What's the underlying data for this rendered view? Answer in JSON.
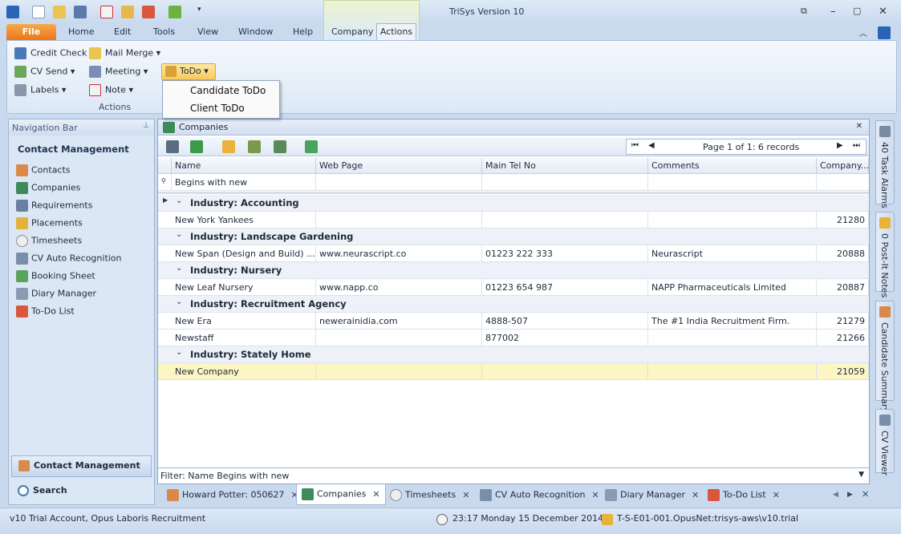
{
  "window": {
    "title": "TriSys Version 10"
  },
  "ribbon_tabs": {
    "file": "File",
    "home": "Home",
    "edit": "Edit",
    "tools": "Tools",
    "view": "View",
    "window": "Window",
    "help": "Help",
    "company": "Company",
    "actions": "Actions"
  },
  "ribbon": {
    "credit_check": "Credit Check",
    "mail_merge": "Mail Merge",
    "cv_send": "CV Send",
    "meeting": "Meeting",
    "labels": "Labels",
    "note": "Note",
    "todo": "ToDo",
    "group_label": "Actions"
  },
  "todo_menu": {
    "candidate": "Candidate ToDo",
    "client": "Client ToDo"
  },
  "nav": {
    "header": "Navigation Bar",
    "section": "Contact Management",
    "items": [
      "Contacts",
      "Companies",
      "Requirements",
      "Placements",
      "Timesheets",
      "CV Auto Recognition",
      "Booking Sheet",
      "Diary Manager",
      "To-Do List"
    ],
    "bottom1": "Contact Management",
    "bottom2": "Search"
  },
  "panel": {
    "title": "Companies",
    "pager": "Page 1 of 1: 6 records",
    "filter_row": "Begins with new",
    "filter_status": "Filter: Name Begins with new"
  },
  "grid": {
    "columns": [
      "Name",
      "Web Page",
      "Main Tel No",
      "Comments",
      "Company..."
    ],
    "groups": [
      {
        "label": "Industry: Accounting",
        "rows": [
          {
            "name": "New York Yankees",
            "web": "",
            "tel": "",
            "comments": "",
            "id": "21280"
          }
        ]
      },
      {
        "label": "Industry: Landscape Gardening",
        "rows": [
          {
            "name": "New Span (Design and Build) ...",
            "web": "www.neurascript.co",
            "tel": "01223 222 333",
            "comments": "Neurascript",
            "id": "20888"
          }
        ]
      },
      {
        "label": "Industry: Nursery",
        "rows": [
          {
            "name": "New Leaf Nursery",
            "web": "www.napp.co",
            "tel": "01223 654 987",
            "comments": "NAPP Pharmaceuticals Limited",
            "id": "20887"
          }
        ]
      },
      {
        "label": "Industry: Recruitment Agency",
        "rows": [
          {
            "name": "New Era",
            "web": "newerainidia.com",
            "tel": "4888-507",
            "comments": "The #1 India Recruitment Firm.",
            "id": "21279"
          },
          {
            "name": "Newstaff",
            "web": "",
            "tel": "877002",
            "comments": "",
            "id": "21266"
          }
        ]
      },
      {
        "label": "Industry: Stately Home",
        "rows": [
          {
            "name": "New Company",
            "web": "",
            "tel": "",
            "comments": "",
            "id": "21059"
          }
        ]
      }
    ]
  },
  "side_tabs": [
    "40 Task Alarms",
    "0 Post-It Notes",
    "Candidate Summary",
    "CV Viewer"
  ],
  "doc_tabs": [
    "Howard Potter: 050627",
    "Companies",
    "Timesheets",
    "CV Auto Recognition",
    "Diary Manager",
    "To-Do List"
  ],
  "status": {
    "account": "v10 Trial Account, Opus Laboris Recruitment",
    "datetime": "23:17  Monday 15 December 2014",
    "server": "T-S-E01-001.OpusNet:trisys-aws\\v10.trial"
  }
}
